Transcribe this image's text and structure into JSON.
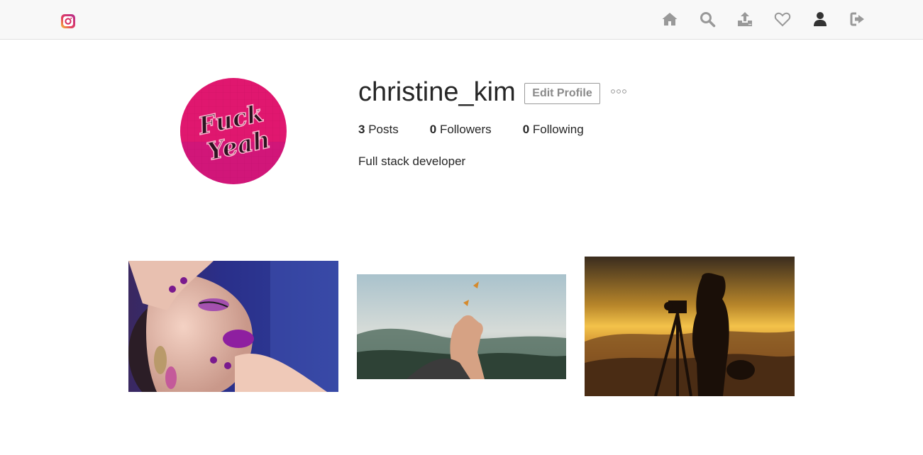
{
  "nav": {
    "logo_icon": "instagram-logo-icon",
    "icons": [
      "home-icon",
      "search-icon",
      "upload-icon",
      "heart-icon",
      "user-icon",
      "logout-icon"
    ],
    "accent": "#999999",
    "active_color": "#333333"
  },
  "profile": {
    "username": "christine_kim",
    "edit_label": "Edit Profile",
    "posts_count": "3",
    "posts_label": "Posts",
    "followers_count": "0",
    "followers_label": "Followers",
    "following_count": "0",
    "following_label": "Following",
    "bio": "Full stack developer",
    "avatar_color": "#e0176f"
  },
  "posts": [
    {
      "subject": "makeup portrait",
      "icon": "photo-icon"
    },
    {
      "subject": "hand with butterfly",
      "icon": "photo-icon"
    },
    {
      "subject": "photographer silhouette at sunset",
      "icon": "photo-icon"
    }
  ]
}
